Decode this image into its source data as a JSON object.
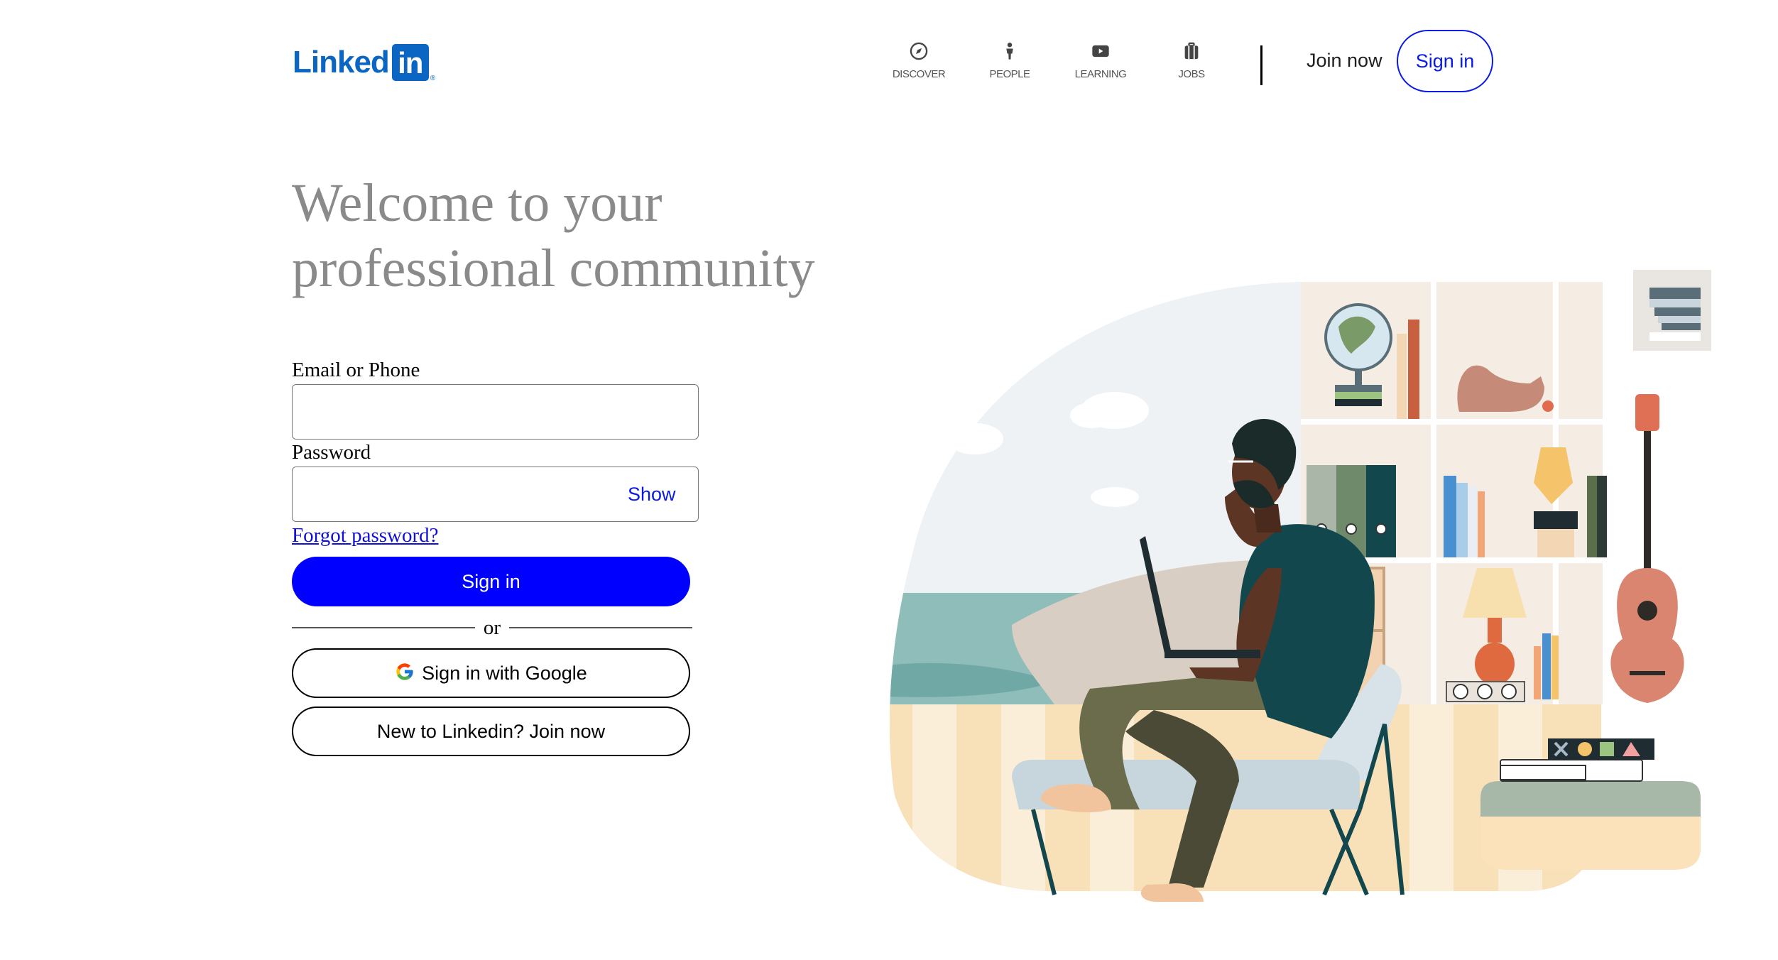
{
  "header": {
    "logo_text": "Linked",
    "logo_box_text": "in",
    "logo_mark": "®",
    "nav": [
      {
        "label": "DISCOVER",
        "icon": "compass-icon"
      },
      {
        "label": "PEOPLE",
        "icon": "person-icon"
      },
      {
        "label": "LEARNING",
        "icon": "play-icon"
      },
      {
        "label": "JOBS",
        "icon": "briefcase-icon"
      }
    ],
    "join_now": "Join now",
    "sign_in": "Sign in"
  },
  "hero": {
    "headline_line1": "Welcome to your",
    "headline_line2": "professional community"
  },
  "form": {
    "email_label": "Email or Phone",
    "email_value": "",
    "password_label": "Password",
    "password_value": "",
    "show_label": "Show",
    "forgot_password": "Forgot password?",
    "sign_in_button": "Sign in",
    "or_text": "or",
    "google_button": "Sign in with Google",
    "join_button": "New to Linkedin? Join now"
  },
  "colors": {
    "brand_blue": "#0a66c2",
    "primary_button": "#0000ff",
    "link_blue": "#0a1ae8",
    "headline_gray": "#8a8a8a"
  },
  "illustration": {
    "icon": "man-with-laptop-illustration"
  }
}
